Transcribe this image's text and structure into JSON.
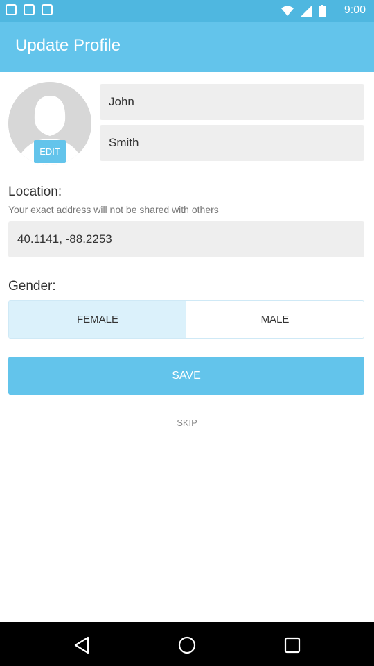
{
  "status_bar": {
    "time": "9:00"
  },
  "app_bar": {
    "title": "Update Profile"
  },
  "profile": {
    "edit_label": "EDIT",
    "first_name": "John",
    "last_name": "Smith"
  },
  "location": {
    "label": "Location:",
    "hint": "Your exact address will not be shared with others",
    "value": "40.1141, -88.2253"
  },
  "gender": {
    "label": "Gender:",
    "options": [
      "FEMALE",
      "MALE"
    ],
    "selected": "FEMALE"
  },
  "actions": {
    "save_label": "SAVE",
    "skip_label": "SKIP"
  },
  "colors": {
    "status_bar": "#4fb7e0",
    "app_bar": "#63c4eb",
    "accent": "#63c4eb",
    "selected_option": "#dbf1fb"
  }
}
